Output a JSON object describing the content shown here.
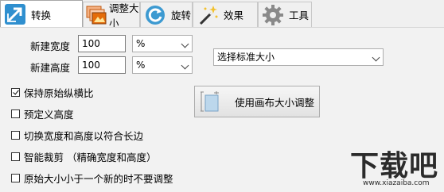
{
  "tabs": [
    {
      "label": "转换",
      "icon": "convert-arrow-icon",
      "active": true
    },
    {
      "label": "调整大小",
      "icon": "resize-photos-icon",
      "active": false
    },
    {
      "label": "旋转",
      "icon": "rotate-icon",
      "active": false
    },
    {
      "label": "效果",
      "icon": "magic-wand-icon",
      "active": false
    },
    {
      "label": "工具",
      "icon": "gear-icon",
      "active": false
    }
  ],
  "resize": {
    "width_label": "新建宽度",
    "width_value": "100",
    "width_unit": "%",
    "height_label": "新建高度",
    "height_value": "100",
    "height_unit": "%",
    "standard_size": "选择标准大小"
  },
  "options": [
    {
      "label": "保持原始纵横比",
      "checked": true
    },
    {
      "label": "预定义高度",
      "checked": false
    },
    {
      "label": "切换宽度和高度以符合长边",
      "checked": false
    },
    {
      "label": "智能裁剪 （精确宽度和高度）",
      "checked": false
    },
    {
      "label": "原始大小小于一个新的时不要调整",
      "checked": false
    }
  ],
  "canvas_button": {
    "label": "使用画布大小调整",
    "icon": "canvas-size-icon"
  },
  "watermark": {
    "text": "下载吧",
    "url": "www.xiazaiba.com"
  }
}
